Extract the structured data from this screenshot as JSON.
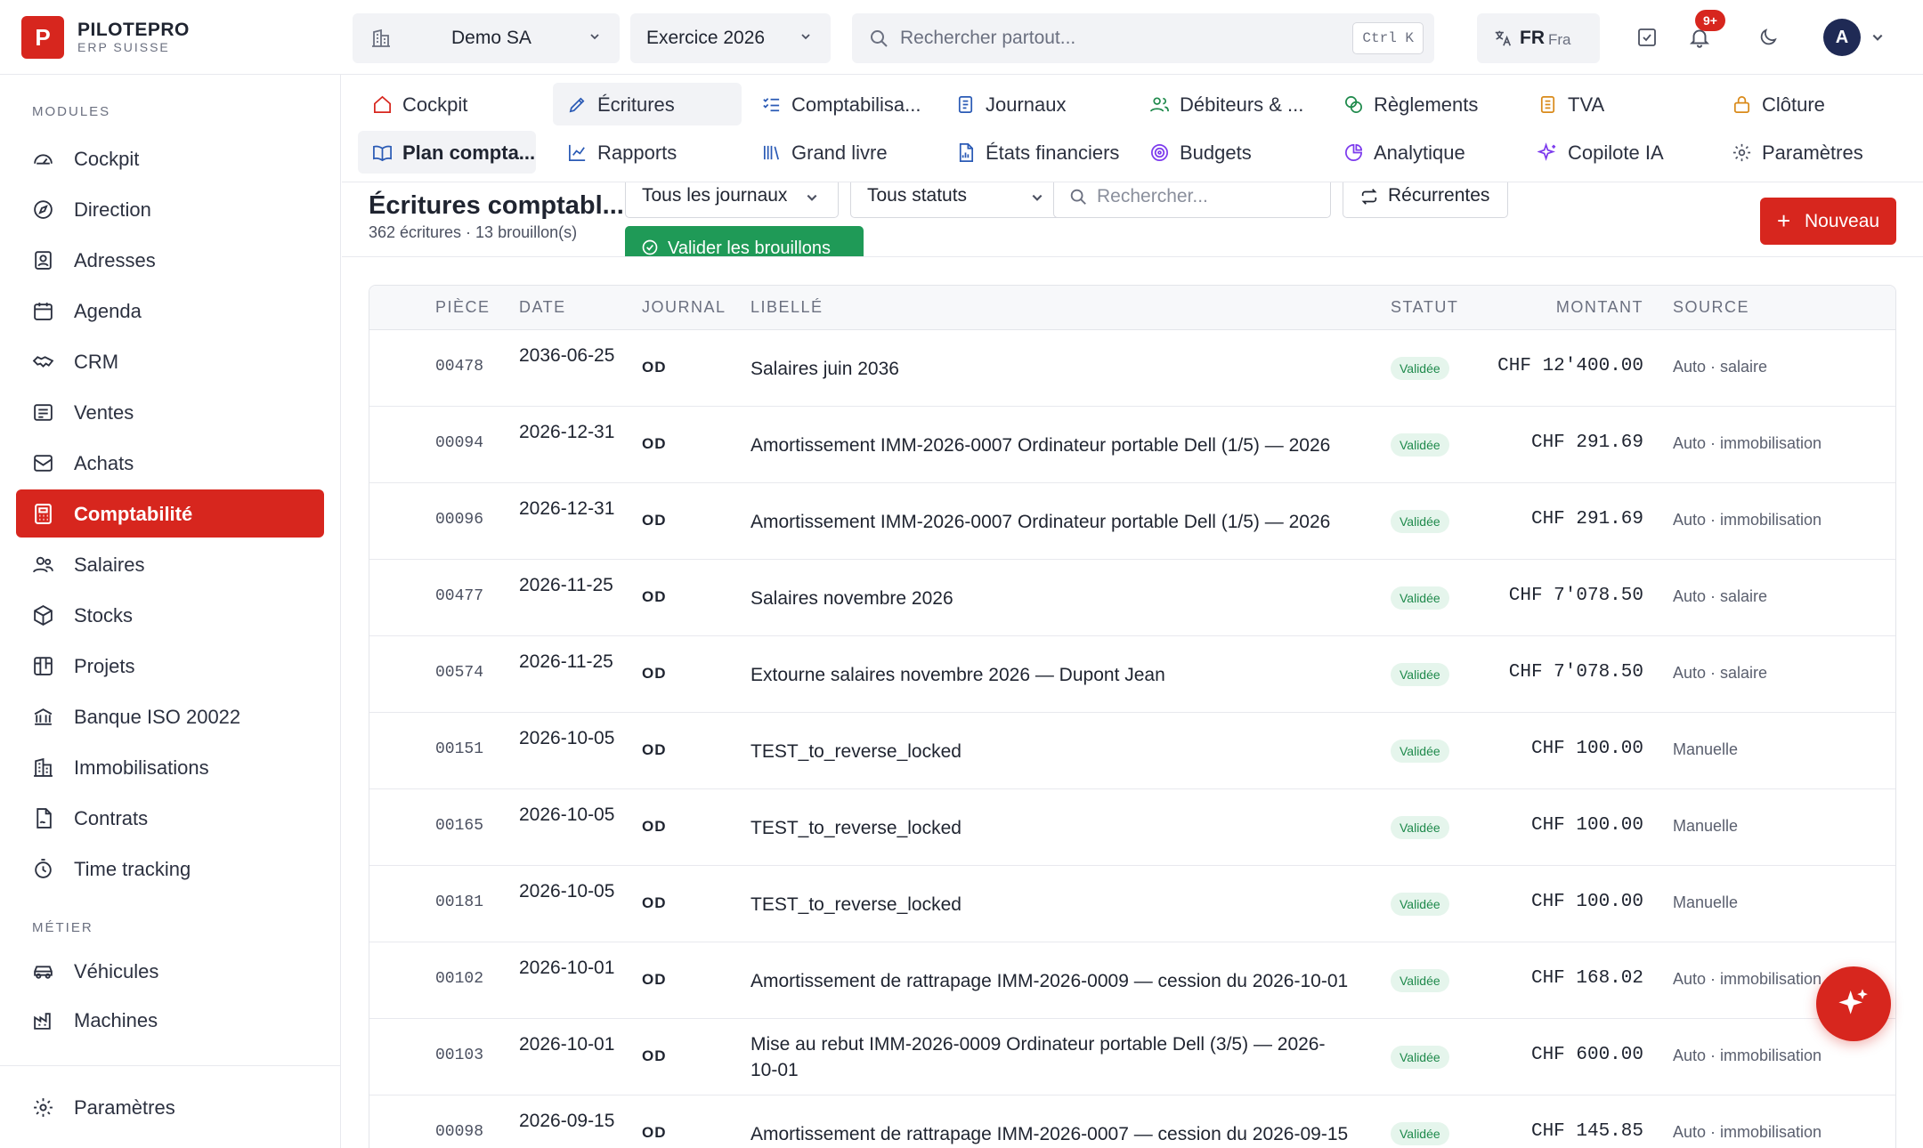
{
  "brand": {
    "logo_letter": "P",
    "name": "PILOTEPRO",
    "subtitle": "ERP SUISSE",
    "color": "#d7261e"
  },
  "topbar": {
    "company": "Demo SA",
    "fiscal_year": "Exercice 2026",
    "search_placeholder": "Rechercher partout...",
    "search_shortcut": "Ctrl K",
    "lang_code": "FR",
    "lang_name": "Fra",
    "notif_count": "9+",
    "avatar_initial": "A"
  },
  "sidebar": {
    "modules_heading": "MODULES",
    "modules": [
      {
        "label": "Cockpit",
        "icon": "gauge-icon"
      },
      {
        "label": "Direction",
        "icon": "compass-icon"
      },
      {
        "label": "Adresses",
        "icon": "contact-icon"
      },
      {
        "label": "Agenda",
        "icon": "calendar-icon"
      },
      {
        "label": "CRM",
        "icon": "handshake-icon"
      },
      {
        "label": "Ventes",
        "icon": "receipt-icon"
      },
      {
        "label": "Achats",
        "icon": "inbox-icon"
      },
      {
        "label": "Comptabilité",
        "icon": "calculator-icon",
        "active": true
      },
      {
        "label": "Salaires",
        "icon": "users-icon"
      },
      {
        "label": "Stocks",
        "icon": "box-icon"
      },
      {
        "label": "Projets",
        "icon": "kanban-icon"
      },
      {
        "label": "Banque ISO 20022",
        "icon": "bank-icon"
      },
      {
        "label": "Immobilisations",
        "icon": "building-icon"
      },
      {
        "label": "Contrats",
        "icon": "file-signature-icon"
      },
      {
        "label": "Time tracking",
        "icon": "stopwatch-icon"
      }
    ],
    "metier_heading": "MÉTIER",
    "metier": [
      {
        "label": "Véhicules",
        "icon": "car-icon"
      },
      {
        "label": "Machines",
        "icon": "factory-icon"
      }
    ],
    "settings": {
      "label": "Paramètres",
      "icon": "gear-icon"
    }
  },
  "tabs": {
    "row1": [
      {
        "label": "Cockpit",
        "icon": "home-icon"
      },
      {
        "label": "Écritures",
        "icon": "pen-icon",
        "active": true
      },
      {
        "label": "Comptabilisa...",
        "icon": "list-check-icon"
      },
      {
        "label": "Journaux",
        "icon": "notebook-icon"
      },
      {
        "label": "Débiteurs & ...",
        "icon": "users-icon"
      },
      {
        "label": "Règlements",
        "icon": "coins-icon"
      },
      {
        "label": "TVA",
        "icon": "document-icon"
      },
      {
        "label": "Clôture",
        "icon": "lock-icon"
      }
    ],
    "row2": [
      {
        "label": "Plan compta...",
        "icon": "book-open-icon",
        "current": true
      },
      {
        "label": "Rapports",
        "icon": "line-chart-icon"
      },
      {
        "label": "Grand livre",
        "icon": "library-icon"
      },
      {
        "label": "États financiers",
        "icon": "file-chart-icon"
      },
      {
        "label": "Budgets",
        "icon": "target-icon"
      },
      {
        "label": "Analytique",
        "icon": "pie-chart-icon"
      },
      {
        "label": "Copilote IA",
        "icon": "sparkles-icon"
      },
      {
        "label": "Paramètres",
        "icon": "gear-icon"
      }
    ]
  },
  "page": {
    "title": "Écritures comptabl...",
    "subtitle": "362 écritures · 13 brouillon(s)",
    "filter_journal": "Tous les journaux",
    "filter_status": "Tous statuts",
    "search_placeholder": "Rechercher...",
    "recurrent_label": "Récurrentes",
    "validate_label": "Valider les brouillons",
    "new_label": "Nouveau"
  },
  "table": {
    "headers": {
      "piece": "PIÈCE",
      "date": "DATE",
      "journal": "JOURNAL",
      "label": "LIBELLÉ",
      "status": "STATUT",
      "amount": "MONTANT",
      "source": "SOURCE"
    },
    "rows": [
      {
        "piece": "00478",
        "date": "2036-06-25",
        "journal": "OD",
        "label": "Salaires juin 2036",
        "status": "Validée",
        "amount": "CHF 12'400.00",
        "source": "Auto · salaire"
      },
      {
        "piece": "00094",
        "date": "2026-12-31",
        "journal": "OD",
        "label": "Amortissement IMM-2026-0007 Ordinateur portable Dell (1/5) — 2026",
        "status": "Validée",
        "amount": "CHF 291.69",
        "source": "Auto · immobilisation"
      },
      {
        "piece": "00096",
        "date": "2026-12-31",
        "journal": "OD",
        "label": "Amortissement IMM-2026-0007 Ordinateur portable Dell (1/5) — 2026",
        "status": "Validée",
        "amount": "CHF 291.69",
        "source": "Auto · immobilisation"
      },
      {
        "piece": "00477",
        "date": "2026-11-25",
        "journal": "OD",
        "label": "Salaires novembre 2026",
        "status": "Validée",
        "amount": "CHF 7'078.50",
        "source": "Auto · salaire"
      },
      {
        "piece": "00574",
        "date": "2026-11-25",
        "journal": "OD",
        "label": "Extourne salaires novembre 2026 — Dupont Jean",
        "status": "Validée",
        "amount": "CHF 7'078.50",
        "source": "Auto · salaire"
      },
      {
        "piece": "00151",
        "date": "2026-10-05",
        "journal": "OD",
        "label": "TEST_to_reverse_locked",
        "status": "Validée",
        "amount": "CHF 100.00",
        "source": "Manuelle"
      },
      {
        "piece": "00165",
        "date": "2026-10-05",
        "journal": "OD",
        "label": "TEST_to_reverse_locked",
        "status": "Validée",
        "amount": "CHF 100.00",
        "source": "Manuelle"
      },
      {
        "piece": "00181",
        "date": "2026-10-05",
        "journal": "OD",
        "label": "TEST_to_reverse_locked",
        "status": "Validée",
        "amount": "CHF 100.00",
        "source": "Manuelle"
      },
      {
        "piece": "00102",
        "date": "2026-10-01",
        "journal": "OD",
        "label": "Amortissement de rattrapage IMM-2026-0009 — cession du 2026-10-01",
        "status": "Validée",
        "amount": "CHF 168.02",
        "source": "Auto · immobilisation"
      },
      {
        "piece": "00103",
        "date": "2026-10-01",
        "journal": "OD",
        "label": "Mise au rebut IMM-2026-0009 Ordinateur portable Dell (3/5) — 2026-10-01",
        "status": "Validée",
        "amount": "CHF 600.00",
        "source": "Auto · immobilisation"
      },
      {
        "piece": "00098",
        "date": "2026-09-15",
        "journal": "OD",
        "label": "Amortissement de rattrapage IMM-2026-0007 — cession du 2026-09-15",
        "status": "Validée",
        "amount": "CHF 145.85",
        "source": "Auto · immobilisation"
      }
    ]
  }
}
